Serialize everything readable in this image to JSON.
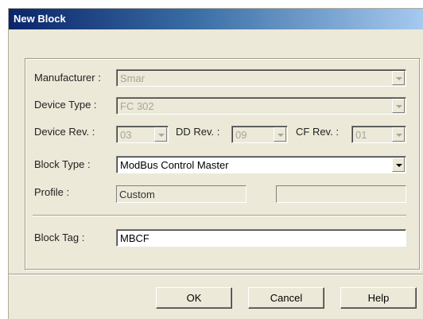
{
  "window": {
    "title": "New Block"
  },
  "form": {
    "manufacturer": {
      "label": "Manufacturer :",
      "value": "Smar"
    },
    "device_type": {
      "label": "Device Type :",
      "value": "FC 302"
    },
    "device_rev": {
      "label": "Device Rev. :",
      "value": "03"
    },
    "dd_rev": {
      "label": "DD Rev. :",
      "value": "09"
    },
    "cf_rev": {
      "label": "CF Rev. :",
      "value": "01"
    },
    "block_type": {
      "label": "Block Type :",
      "value": "ModBus Control Master"
    },
    "profile": {
      "label": "Profile :",
      "value": "Custom",
      "value2": ""
    },
    "block_tag": {
      "label": "Block Tag :",
      "value": "MBCF"
    }
  },
  "buttons": {
    "ok": "OK",
    "cancel": "Cancel",
    "help": "Help"
  },
  "icons": {
    "combo_arrow": "chevron-down-icon"
  },
  "colors": {
    "titlebar_start": "#0a246a",
    "titlebar_end": "#a6caf0",
    "dialog_bg": "#ece9d8"
  }
}
